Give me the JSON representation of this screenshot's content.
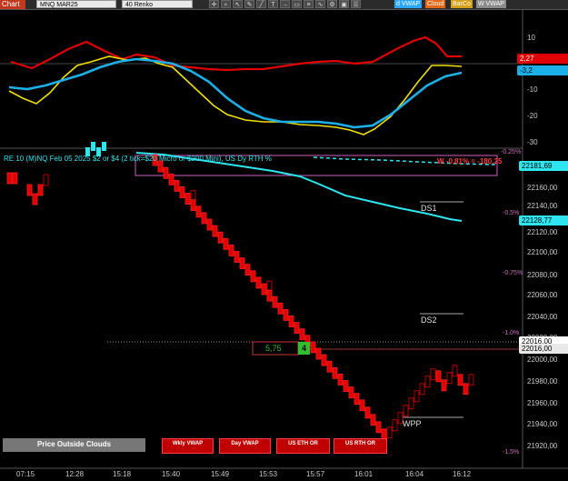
{
  "toolbar": {
    "chart_label": "Chart",
    "instrument": "MNQ MAR25",
    "bar_type": "40 Renko",
    "chips": [
      "d VWAP",
      "Cloud",
      "BarCo",
      "W VWAP"
    ]
  },
  "oscillator": {
    "axis_labels": [
      "10",
      "-10",
      "-20",
      "-30"
    ],
    "line_value": "2,27",
    "line_value_2": "-3,2"
  },
  "price_panel": {
    "header_text": "RE 10 (M)NQ Feb 05 2025 $2 or $4 (2 tick=$20 Micro or $200 Mini), US Dy RTH %",
    "pct_tag": "W -0.81% = -180.25",
    "pct_levels": [
      "-0.25%",
      "-0.5%",
      "-0.75%",
      "-1.0%",
      "-1.5%"
    ],
    "price_labels": [
      "22160,00",
      "22140,00",
      "22120,00",
      "22100,00",
      "22080,00",
      "22060,00",
      "22040,00",
      "22020,00",
      "22000,00",
      "21980,00",
      "21960,00",
      "21940,00",
      "21920,00"
    ],
    "tag_top": "22181,69",
    "tag_mid": "22128,77",
    "tag_last_1": "22016,00",
    "tag_last_2": "22016,00",
    "ds1": "DS1",
    "ds2": "DS2",
    "wpp": "WPP",
    "order_qty": "5,75",
    "order_count": "4"
  },
  "buttons": {
    "price_outside_clouds": "Price Outside Clouds",
    "wkly_vwap": "Wkly VWAP",
    "day_vwap": "Day VWAP",
    "us_eth_or": "US ETH OR",
    "us_rth_or": "US RTH OR"
  },
  "time_axis": [
    "07:15",
    "12:28",
    "15:18",
    "15:40",
    "15:49",
    "15:53",
    "15:57",
    "16:01",
    "16:04",
    "16:12"
  ]
}
